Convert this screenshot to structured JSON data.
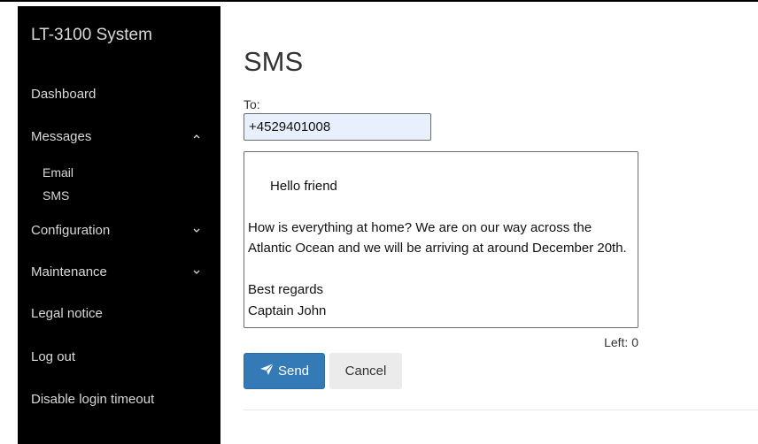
{
  "sidebar": {
    "brand": "LT-3100 System",
    "items": [
      {
        "label": "Dashboard"
      },
      {
        "label": "Messages",
        "expanded": true,
        "sub": [
          {
            "label": "Email"
          },
          {
            "label": "SMS"
          }
        ]
      },
      {
        "label": "Configuration",
        "expanded": false
      },
      {
        "label": "Maintenance",
        "expanded": false
      },
      {
        "label": "Legal notice"
      },
      {
        "label": "Log out"
      },
      {
        "label": "Disable login timeout"
      }
    ]
  },
  "main": {
    "title": "SMS",
    "to_label": "To:",
    "to_value": "+4529401008",
    "message": "Hello friend\n\nHow is everything at home? We are on our way across the Atlantic Ocean and we will be arriving at around December 20th.\n\nBest regards\nCaptain John",
    "left_text": "Left: 0",
    "send_label": "Send",
    "cancel_label": "Cancel"
  },
  "colors": {
    "sidebar_bg": "#000000",
    "primary": "#337ab7",
    "input_autofill": "#e8f0fe"
  },
  "icons": {
    "send": "paper-plane-icon",
    "expand": "chevron-up-icon",
    "collapse": "chevron-down-icon"
  }
}
